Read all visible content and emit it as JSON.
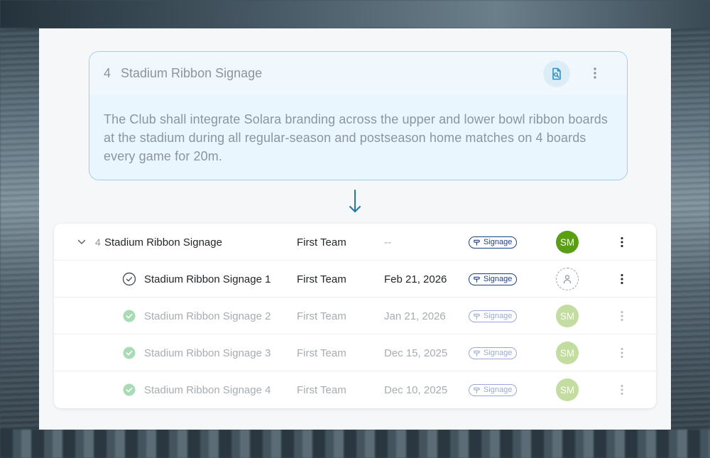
{
  "clause": {
    "number": "4",
    "title": "Stadium Ribbon Signage",
    "body": "The Club shall integrate Solara branding across the upper and lower bowl ribbon boards at the stadium during all regular-season and postseason home matches on 4 boards every game for 20m.",
    "doc_icon": "document-search-icon",
    "menu_icon": "more-vertical-icon"
  },
  "table": {
    "parent": {
      "number": "4",
      "name": "Stadium Ribbon Signage",
      "team": "First Team",
      "date": "--",
      "tag": "Signage",
      "avatar": "SM"
    },
    "children": [
      {
        "name": "Stadium Ribbon Signage 1",
        "team": "First Team",
        "date": "Feb 21, 2026",
        "tag": "Signage",
        "avatar": "",
        "status": "pending",
        "completed": false
      },
      {
        "name": "Stadium Ribbon Signage 2",
        "team": "First Team",
        "date": "Jan 21, 2026",
        "tag": "Signage",
        "avatar": "SM",
        "status": "done",
        "completed": true
      },
      {
        "name": "Stadium Ribbon Signage 3",
        "team": "First Team",
        "date": "Dec 15, 2025",
        "tag": "Signage",
        "avatar": "SM",
        "status": "done",
        "completed": true
      },
      {
        "name": "Stadium Ribbon Signage 4",
        "team": "First Team",
        "date": "Dec 10, 2025",
        "tag": "Signage",
        "avatar": "SM",
        "status": "done",
        "completed": true
      }
    ]
  },
  "colors": {
    "accent": "#1f78a8",
    "tag_active": "#1d3f8a",
    "tag_muted": "#9aa9d3",
    "avatar_active": "#5a9e12",
    "avatar_muted": "#c3dca0",
    "check_done": "#a7dcb5"
  }
}
